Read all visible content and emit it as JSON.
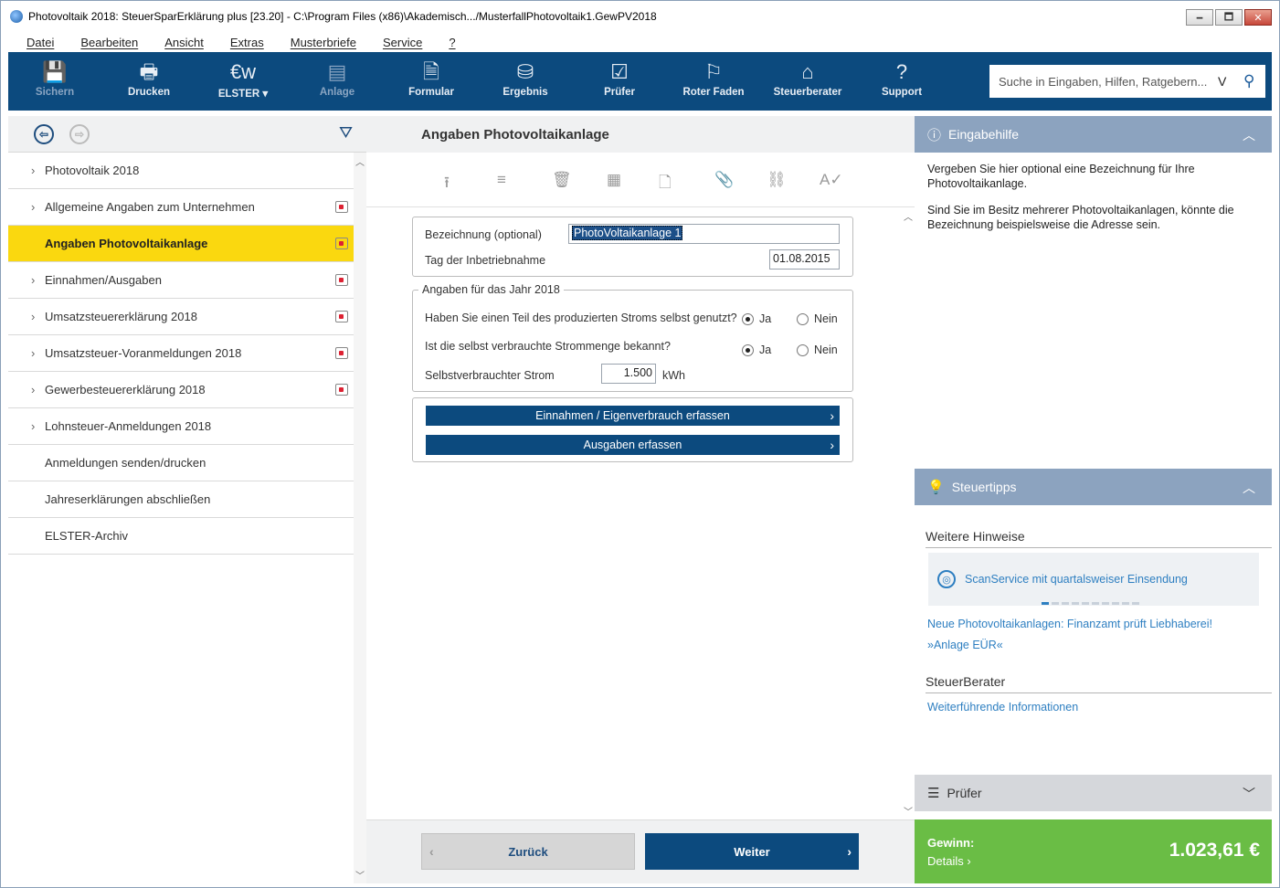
{
  "window": {
    "title": "Photovoltaik 2018: SteuerSparErklärung plus [23.20] - C:\\Program Files (x86)\\Akademisch.../MusterfallPhotovoltaik1.GewPV2018",
    "minimize": "🗕",
    "maximize": "🗖",
    "close": "✕"
  },
  "menu": [
    "Datei",
    "Bearbeiten",
    "Ansicht",
    "Extras",
    "Musterbriefe",
    "Service",
    "?"
  ],
  "toolbar": {
    "items": [
      {
        "label": "Sichern",
        "icon": "save-icon",
        "glyph": "💾",
        "enabled": false
      },
      {
        "label": "Drucken",
        "icon": "print-icon",
        "glyph": "🖶",
        "enabled": true
      },
      {
        "label": "ELSTER",
        "icon": "elster-icon",
        "glyph": "€w",
        "enabled": true
      },
      {
        "label": "Anlage",
        "icon": "attachment-icon",
        "glyph": "▤",
        "enabled": false
      },
      {
        "label": "Formular",
        "icon": "form-icon",
        "glyph": "🗎",
        "enabled": true
      },
      {
        "label": "Ergebnis",
        "icon": "coins-icon",
        "glyph": "⛁",
        "enabled": true
      },
      {
        "label": "Prüfer",
        "icon": "checklist-icon",
        "glyph": "☑",
        "enabled": true
      },
      {
        "label": "Roter Faden",
        "icon": "signpost-icon",
        "glyph": "⚐",
        "enabled": true
      },
      {
        "label": "Steuerberater",
        "icon": "advisor-icon",
        "glyph": "⌂",
        "enabled": true
      },
      {
        "label": "Support",
        "icon": "help-icon",
        "glyph": "?",
        "enabled": true
      }
    ],
    "elster_dropdown": "▾",
    "search_placeholder": "Suche in Eingaben, Hilfen, Ratgebern...",
    "search_v": "V",
    "search_icon": "⚲"
  },
  "nav": {
    "back": "⇦",
    "forward": "⇨",
    "filter": "⛛",
    "items": [
      {
        "label": "Photovoltaik 2018",
        "chevron": true,
        "badge": false,
        "active": false
      },
      {
        "label": "Allgemeine Angaben zum Unternehmen",
        "chevron": true,
        "badge": true,
        "active": false
      },
      {
        "label": "Angaben Photovoltaikanlage",
        "chevron": false,
        "badge": true,
        "active": true
      },
      {
        "label": "Einnahmen/Ausgaben",
        "chevron": true,
        "badge": true,
        "active": false
      },
      {
        "label": "Umsatzsteuererklärung 2018",
        "chevron": true,
        "badge": true,
        "active": false
      },
      {
        "label": "Umsatzsteuer-Voranmeldungen 2018",
        "chevron": true,
        "badge": true,
        "active": false
      },
      {
        "label": "Gewerbesteuererklärung 2018",
        "chevron": true,
        "badge": true,
        "active": false
      },
      {
        "label": "Lohnsteuer-Anmeldungen 2018",
        "chevron": true,
        "badge": false,
        "active": false
      },
      {
        "label": "Anmeldungen senden/drucken",
        "chevron": false,
        "badge": false,
        "active": false
      },
      {
        "label": "Jahreserklärungen abschließen",
        "chevron": false,
        "badge": false,
        "active": false
      },
      {
        "label": "ELSTER-Archiv",
        "chevron": false,
        "badge": false,
        "active": false
      }
    ]
  },
  "center": {
    "title": "Angaben Photovoltaikanlage",
    "form": {
      "bezeichnung_label": "Bezeichnung (optional)",
      "bezeichnung_value": "PhotoVoltaikanlage 1",
      "tag_label": "Tag der Inbetriebnahme",
      "tag_value": "01.08.2015",
      "group_title": "Angaben für das Jahr 2018",
      "q1": "Haben Sie einen Teil des produzierten Stroms selbst genutzt?",
      "q2": "Ist die selbst verbrauchte Strommenge bekannt?",
      "ja": "Ja",
      "nein": "Nein",
      "strom_label": "Selbstverbrauchter Strom",
      "strom_value": "1.500",
      "strom_unit": "kWh"
    },
    "btn_einnahmen": "Einnahmen / Eigenverbrauch erfassen",
    "btn_ausgaben": "Ausgaben erfassen",
    "back": "Zurück",
    "next": "Weiter"
  },
  "right": {
    "help_title": "Eingabehilfe",
    "help_p1": "Vergeben Sie hier optional eine Bezeichnung für Ihre Photovoltaikanlage.",
    "help_p2": "Sind Sie im Besitz mehrerer Photovoltaikanlagen, könnte die Bezeichnung beispielsweise die Adresse sein.",
    "tips_title": "Steuertipps",
    "weitere": "Weitere Hinweise",
    "scan": "ScanService mit quartalsweiser Einsendung",
    "link1": "Neue Photovoltaikanlagen: Finanzamt prüft Liebhaberei!",
    "link2": "»Anlage EÜR«",
    "steuerberater": "SteuerBerater",
    "link3": "Weiterführende Informationen",
    "pruefer": "Prüfer",
    "gewinn_label": "Gewinn:",
    "details": "Details",
    "gewinn_value": "1.023,61 €"
  },
  "colors": {
    "toolbar": "#0c4a7e",
    "active_nav": "#fad80f",
    "panel_head": "#8ca3bf",
    "gain": "#6abd45",
    "link": "#2e7fc1"
  }
}
